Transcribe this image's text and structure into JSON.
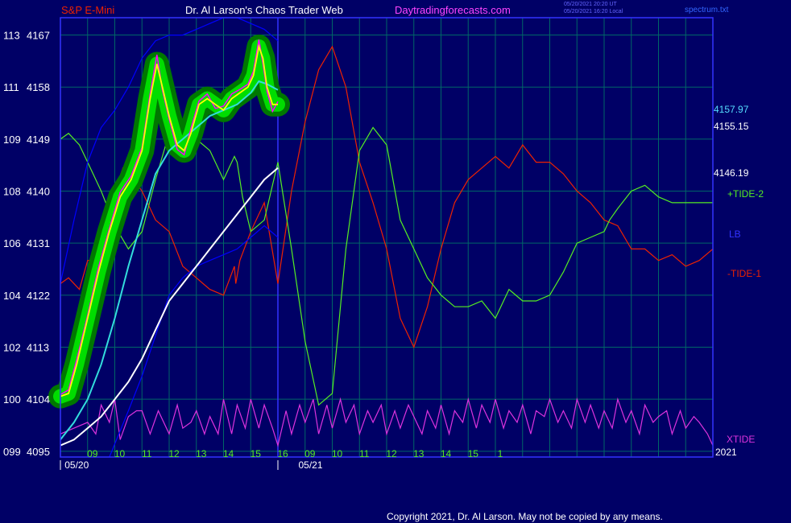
{
  "header": {
    "instrument": "S&P E-Mini",
    "site_title": "Dr. Al Larson's Chaos Trader Web",
    "site_url": "Daytradingforecasts.com",
    "timestamp_ut": "05/20/2021 20:20 UT",
    "timestamp_local": "05/20/2021 16:20 Local",
    "spectrum_file": "spectrum.txt"
  },
  "footer": {
    "copyright": "Copyright 2021, Dr. Al Larson. May not be copied by any means."
  },
  "colors": {
    "background": "#000066",
    "frame": "#3333ff",
    "grid": "#006666",
    "price": "#ffff00",
    "price_fast": "#ff00ff",
    "price_halo": "#00dd00",
    "ma_fast": "#33dddd",
    "ma_slow": "#ffffff",
    "tide2": "#55ee22",
    "tide1": "#ee2200",
    "lb": "#0000ff",
    "xtide": "#dd33dd"
  },
  "chart_data": {
    "type": "line",
    "title": "S&P E-Mini",
    "y_axis_left_labels": [
      {
        "wave": "113",
        "price": "4167"
      },
      {
        "wave": "111",
        "price": "4158"
      },
      {
        "wave": "109",
        "price": "4149"
      },
      {
        "wave": "108",
        "price": "4140"
      },
      {
        "wave": "106",
        "price": "4131"
      },
      {
        "wave": "104",
        "price": "4122"
      },
      {
        "wave": "102",
        "price": "4113"
      },
      {
        "wave": "100",
        "price": "4104"
      },
      {
        "wave": "099",
        "price": "4095"
      }
    ],
    "price_ticks": [
      4167,
      4158,
      4149,
      4140,
      4131,
      4122,
      4113,
      4104,
      4095
    ],
    "ylim": [
      4094,
      4170
    ],
    "x_hour_labels": [
      "09",
      "10",
      "11",
      "12",
      "13",
      "14",
      "15",
      "16",
      "09",
      "10",
      "11",
      "12",
      "13",
      "14",
      "15",
      "1"
    ],
    "x_date_labels": [
      "05/20",
      "05/21"
    ],
    "x_year_label": "2021",
    "x_range_hours": [
      8.0,
      32.0
    ],
    "day_divider_hour": 16.0,
    "right_price_labels": [
      {
        "text": "4157.97",
        "value": 4157.97,
        "color": "#55ddff"
      },
      {
        "text": "4155.15",
        "value": 4155.15,
        "color": "#ffffff"
      },
      {
        "text": "4146.19",
        "value": 4146.19,
        "color": "#ffffff"
      }
    ],
    "series_labels": [
      {
        "text": "+TIDE-2",
        "color": "#55ee22"
      },
      {
        "text": "LB",
        "color": "#3333ff"
      },
      {
        "text": "-TIDE-1",
        "color": "#ee2200"
      },
      {
        "text": "XTIDE",
        "color": "#dd33dd"
      }
    ],
    "series": [
      {
        "name": "Price",
        "color": "#ffff00",
        "x": [
          8.0,
          8.3,
          8.6,
          9.0,
          9.4,
          9.8,
          10.2,
          10.6,
          11.0,
          11.3,
          11.55,
          11.75,
          12.0,
          12.3,
          12.55,
          12.8,
          13.1,
          13.4,
          13.7,
          14.0,
          14.3,
          14.6,
          14.9,
          15.1,
          15.3,
          15.45,
          15.6,
          15.8,
          16.0
        ],
        "y": [
          4104.5,
          4105,
          4110,
          4118,
          4126,
          4133,
          4139,
          4142,
          4147,
          4156,
          4162,
          4158,
          4153,
          4148,
          4147,
          4150,
          4155,
          4156,
          4155,
          4154,
          4156,
          4157,
          4158,
          4160,
          4165,
          4163,
          4158,
          4155,
          4155
        ]
      },
      {
        "name": "Price-fast",
        "color": "#ff00ff",
        "x": [
          8.0,
          8.3,
          8.6,
          9.0,
          9.4,
          9.8,
          10.2,
          10.6,
          11.0,
          11.3,
          11.55,
          11.75,
          12.0,
          12.3,
          12.55,
          12.8,
          13.1,
          13.4,
          13.7,
          14.0,
          14.3,
          14.6,
          14.9,
          15.1,
          15.3,
          15.45,
          15.6,
          15.8,
          16.0
        ],
        "y": [
          4104.8,
          4105.6,
          4110.8,
          4118.5,
          4126.8,
          4133.5,
          4139.8,
          4142.6,
          4147.5,
          4156.8,
          4163.6,
          4157.5,
          4152.5,
          4147.2,
          4146.3,
          4150.8,
          4155.6,
          4156.8,
          4154.3,
          4154.7,
          4156.8,
          4157.6,
          4158.5,
          4160.7,
          4166.2,
          4162.1,
          4157.3,
          4153.8,
          4155.5
        ]
      },
      {
        "name": "MA-fast",
        "color": "#33dddd",
        "x": [
          8.0,
          8.5,
          9.0,
          9.5,
          10.0,
          10.5,
          11.0,
          11.5,
          12.0,
          12.5,
          13.0,
          13.5,
          14.0,
          14.5,
          15.0,
          15.3,
          15.6,
          16.0
        ],
        "y": [
          4097,
          4100,
          4104,
          4110,
          4118,
          4127,
          4135,
          4143,
          4147,
          4149,
          4151,
          4153,
          4154,
          4155,
          4157,
          4159,
          4158.5,
          4157.5
        ]
      },
      {
        "name": "MA-slow",
        "color": "#ffffff",
        "x": [
          8.0,
          8.5,
          9.0,
          9.5,
          10.0,
          10.5,
          11.0,
          11.5,
          12.0,
          12.5,
          13.0,
          13.5,
          14.0,
          14.5,
          15.0,
          15.5,
          16.0
        ],
        "y": [
          4096,
          4097,
          4099,
          4101,
          4104,
          4107,
          4111,
          4116,
          4121,
          4124,
          4127,
          4130,
          4133,
          4136,
          4139,
          4142,
          4144
        ]
      },
      {
        "name": "LB",
        "color": "#0000ff",
        "x": [
          8.0,
          8.5,
          9.0,
          9.5,
          10.0,
          10.5,
          11.0,
          11.5,
          12.0,
          12.5,
          13.0,
          13.5,
          14.0,
          14.5,
          15.0,
          15.5,
          16.0
        ],
        "y": [
          4124,
          4135,
          4145,
          4151,
          4154,
          4158,
          4163,
          4166,
          4167,
          4167,
          4168,
          4169,
          4170,
          4170,
          4169,
          4168,
          4166
        ]
      },
      {
        "name": "LB-low",
        "color": "#0000ff",
        "x": [
          9.8,
          10.5,
          11.0,
          11.5,
          12.0,
          12.5,
          13.0,
          13.5,
          14.0,
          14.5,
          15.0,
          15.5,
          16.0
        ],
        "y": [
          4094,
          4102,
          4108,
          4115,
          4122,
          4125,
          4127,
          4128,
          4129,
          4130,
          4132,
          4134,
          4132
        ]
      },
      {
        "name": "+TIDE-2",
        "color": "#55ee22",
        "x": [
          8.0,
          8.3,
          8.7,
          9.0,
          9.5,
          10.0,
          10.5,
          11.0,
          11.5,
          12.0,
          12.5,
          13.0,
          13.5,
          14.0,
          14.4,
          14.5,
          14.7,
          15.0,
          15.5,
          16.0,
          16.5,
          17.0,
          17.5,
          18.0,
          18.5,
          19.0,
          19.5,
          20.0,
          20.5,
          21.0,
          21.5,
          22.0,
          22.5,
          23.0,
          23.5,
          24.0,
          24.5,
          25.0,
          25.5,
          26.0,
          26.5,
          27.0,
          27.5,
          28.0,
          28.2,
          28.5,
          29.0,
          29.5,
          30.0,
          30.5,
          31.0,
          31.5,
          32.0
        ],
        "y": [
          4149,
          4150,
          4148,
          4145,
          4140,
          4134,
          4130,
          4133,
          4142,
          4150,
          4152,
          4149,
          4147,
          4142,
          4146,
          4145,
          4139,
          4133,
          4135,
          4145,
          4130,
          4114,
          4103,
          4105,
          4130,
          4147,
          4151,
          4148,
          4135,
          4130,
          4125,
          4122,
          4120,
          4120,
          4121,
          4118,
          4123,
          4121,
          4121,
          4122,
          4126,
          4131,
          4132,
          4133,
          4135,
          4137,
          4140,
          4141,
          4139,
          4138,
          4138,
          4138,
          4138
        ]
      },
      {
        "name": "-TIDE-1",
        "color": "#ee2200",
        "x": [
          8.0,
          8.3,
          8.7,
          9.0,
          9.5,
          10.0,
          10.3,
          10.7,
          11.0,
          11.5,
          12.0,
          12.5,
          13.0,
          13.5,
          14.0,
          14.4,
          14.45,
          14.6,
          15.0,
          15.5,
          16.0,
          16.5,
          17.0,
          17.5,
          18.0,
          18.5,
          19.0,
          19.5,
          20.0,
          20.5,
          21.0,
          21.5,
          22.0,
          22.5,
          23.0,
          23.5,
          24.0,
          24.5,
          25.0,
          25.5,
          26.0,
          26.5,
          27.0,
          27.5,
          28.0,
          28.5,
          29.0,
          29.5,
          30.0,
          30.5,
          31.0,
          31.5,
          32.0
        ],
        "y": [
          4124,
          4125,
          4123,
          4128,
          4128,
          4140,
          4144,
          4142,
          4140,
          4135,
          4133,
          4127,
          4125,
          4123,
          4122,
          4127,
          4124,
          4128,
          4133,
          4138,
          4124,
          4140,
          4152,
          4161,
          4165,
          4158,
          4145,
          4138,
          4130,
          4118,
          4113,
          4120,
          4130,
          4138,
          4142,
          4144,
          4146,
          4144,
          4148,
          4145,
          4145,
          4143,
          4140,
          4138,
          4135,
          4134,
          4130,
          4130,
          4128,
          4129,
          4127,
          4128,
          4130
        ]
      },
      {
        "name": "XTIDE",
        "color": "#dd33dd",
        "x": [
          8.0,
          8.5,
          9.0,
          9.3,
          9.5,
          9.8,
          10.0,
          10.2,
          10.5,
          10.8,
          11.0,
          11.3,
          11.6,
          12.0,
          12.3,
          12.5,
          12.8,
          13.0,
          13.3,
          13.5,
          13.8,
          14.0,
          14.3,
          14.5,
          14.8,
          15.0,
          15.3,
          15.5,
          15.8,
          16.0,
          16.3,
          16.5,
          16.8,
          17.0,
          17.3,
          17.5,
          17.8,
          18.0,
          18.3,
          18.5,
          18.8,
          19.0,
          19.3,
          19.5,
          19.8,
          20.0,
          20.3,
          20.5,
          20.8,
          21.0,
          21.3,
          21.5,
          21.8,
          22.0,
          22.3,
          22.5,
          22.8,
          23.0,
          23.3,
          23.5,
          23.8,
          24.0,
          24.3,
          24.5,
          24.8,
          25.0,
          25.3,
          25.5,
          25.8,
          26.0,
          26.3,
          26.5,
          26.8,
          27.0,
          27.3,
          27.5,
          27.8,
          28.0,
          28.3,
          28.5,
          28.8,
          29.0,
          29.3,
          29.5,
          29.8,
          30.0,
          30.3,
          30.5,
          30.8,
          31.0,
          31.3,
          31.5,
          31.8,
          32.0
        ],
        "y": [
          4098,
          4099,
          4100,
          4098,
          4103,
          4100,
          4104,
          4097,
          4101,
          4102,
          4102,
          4098,
          4102,
          4098,
          4103,
          4099,
          4100,
          4102,
          4098,
          4101,
          4098,
          4104,
          4098,
          4103,
          4099,
          4104,
          4099,
          4103,
          4099,
          4096,
          4102,
          4098,
          4103,
          4100,
          4104,
          4098,
          4103,
          4099,
          4104,
          4100,
          4103,
          4098,
          4102,
          4100,
          4103,
          4098,
          4102,
          4099,
          4103,
          4101,
          4098,
          4102,
          4099,
          4103,
          4098,
          4102,
          4100,
          4104,
          4099,
          4103,
          4100,
          4104,
          4099,
          4102,
          4100,
          4103,
          4098,
          4102,
          4101,
          4104,
          4100,
          4102,
          4099,
          4104,
          4100,
          4103,
          4099,
          4102,
          4099,
          4104,
          4100,
          4102,
          4098,
          4103,
          4100,
          4101,
          4102,
          4098,
          4102,
          4099,
          4101,
          4100,
          4098,
          4096
        ]
      }
    ],
    "grid": true
  }
}
